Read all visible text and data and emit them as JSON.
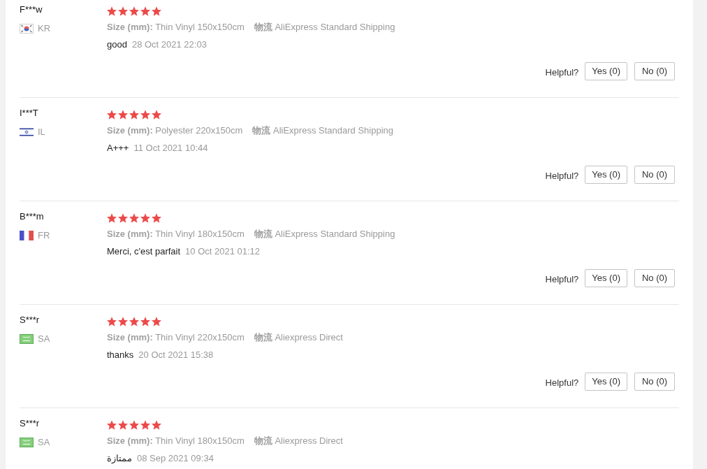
{
  "reviews": [
    {
      "reviewer": "F***w",
      "country": {
        "code": "KR",
        "kind": "korea"
      },
      "stars": 5,
      "attributes": [
        {
          "label": "Size (mm):",
          "value": "Thin Vinyl 150x150cm"
        },
        {
          "label": "物流",
          "value": "AliExpress Standard Shipping"
        }
      ],
      "text": "good",
      "date": "28 Oct 2021 22:03",
      "helpful": {
        "label": "Helpful?",
        "yes": "Yes (0)",
        "no": "No (0)"
      }
    },
    {
      "reviewer": "I***T",
      "country": {
        "code": "IL",
        "kind": "israel"
      },
      "stars": 5,
      "attributes": [
        {
          "label": "Size (mm):",
          "value": "Polyester 220x150cm"
        },
        {
          "label": "物流",
          "value": "AliExpress Standard Shipping"
        }
      ],
      "text": "A+++",
      "date": "11 Oct 2021 10:44",
      "helpful": {
        "label": "Helpful?",
        "yes": "Yes (0)",
        "no": "No (0)"
      }
    },
    {
      "reviewer": "B***m",
      "country": {
        "code": "FR",
        "kind": "france"
      },
      "stars": 5,
      "attributes": [
        {
          "label": "Size (mm):",
          "value": "Thin Vinyl 180x150cm"
        },
        {
          "label": "物流",
          "value": "AliExpress Standard Shipping"
        }
      ],
      "text": "Merci, c'est parfait",
      "date": "10 Oct 2021 01:12",
      "helpful": {
        "label": "Helpful?",
        "yes": "Yes (0)",
        "no": "No (0)"
      }
    },
    {
      "reviewer": "S***r",
      "country": {
        "code": "SA",
        "kind": "saudi"
      },
      "stars": 5,
      "attributes": [
        {
          "label": "Size (mm):",
          "value": "Thin Vinyl 220x150cm"
        },
        {
          "label": "物流",
          "value": "Aliexpress Direct"
        }
      ],
      "text": "thanks",
      "date": "20 Oct 2021 15:38",
      "helpful": {
        "label": "Helpful?",
        "yes": "Yes (0)",
        "no": "No (0)"
      }
    },
    {
      "reviewer": "S***r",
      "country": {
        "code": "SA",
        "kind": "saudi"
      },
      "stars": 5,
      "attributes": [
        {
          "label": "Size (mm):",
          "value": "Thin Vinyl 180x150cm"
        },
        {
          "label": "物流",
          "value": "Aliexpress Direct"
        }
      ],
      "text": "ممتازة",
      "date": "08 Sep 2021 09:34"
    }
  ]
}
